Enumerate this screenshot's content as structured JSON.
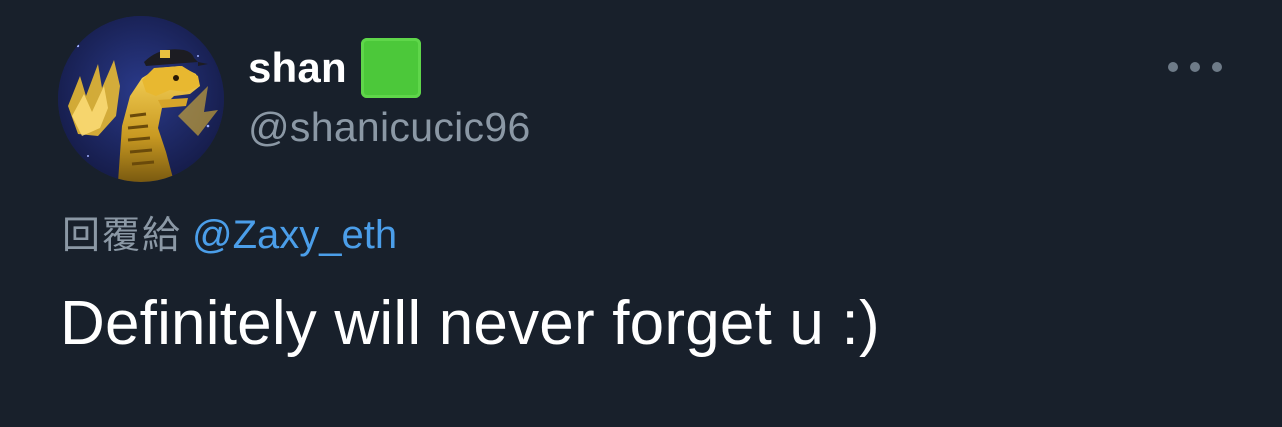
{
  "tweet": {
    "author": {
      "display_name": "shan",
      "name_emoji": "green-square-emoji",
      "handle": "@shanicucic96",
      "avatar": "avatar-golden-dragon-with-cap"
    },
    "more_icon": "ellipsis-icon",
    "reply_prefix": "回覆給",
    "reply_to": "@Zaxy_eth",
    "text": "Definitely will never forget u :)"
  },
  "colors": {
    "background": "#18202b",
    "primary_text": "#ffffff",
    "secondary_text": "#8b98a5",
    "link": "#4b9ee9",
    "emoji_green": "#4cc83a"
  }
}
